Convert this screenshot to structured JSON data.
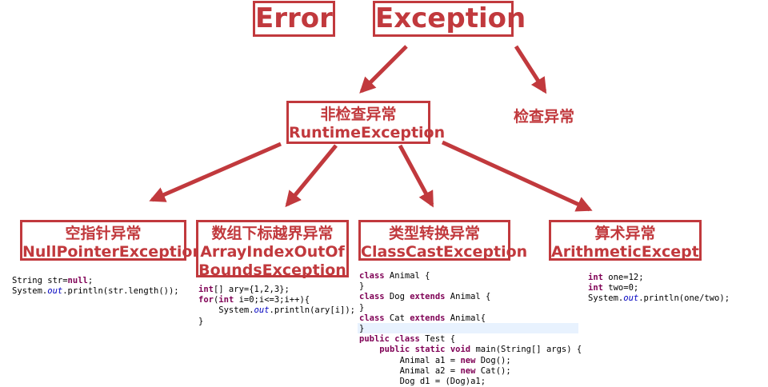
{
  "colors": {
    "accent": "#c1393d",
    "keyword": "#7f0055",
    "field": "#0000c0",
    "highlight": "#e8f2fe"
  },
  "top": {
    "error": "Error",
    "exception": "Exception"
  },
  "mid": {
    "unchecked_cn": "非检查异常",
    "unchecked_en": "RuntimeException",
    "checked_cn": "检查异常"
  },
  "leaves": [
    {
      "cn": "空指针异常",
      "en": "NullPointerException"
    },
    {
      "cn": "数组下标越界异常",
      "en": "ArrayIndexOutOfBoundsException",
      "en1": "ArrayIndexOutOf",
      "en2": "BoundsException"
    },
    {
      "cn": "类型转换异常",
      "en": "ClassCastException"
    },
    {
      "cn": "算术异常",
      "en": "ArithmeticException",
      "en_visible": "ArithmeticExceptior"
    }
  ],
  "code": {
    "null_pointer": [
      "String str=null;",
      "System.out.println(str.length());"
    ],
    "array_index": [
      "int[] ary={1,2,3};",
      "for(int i=0;i<=3;i++){",
      "    System.out.println(ary[i]);",
      "}"
    ],
    "class_cast": [
      "class Animal {",
      "}",
      "class Dog extends Animal {",
      "}",
      "class Cat extends Animal{",
      "}",
      "public class Test {",
      "    public static void main(String[] args) {",
      "        Animal a1 = new Dog();",
      "        Animal a2 = new Cat();",
      "        Dog d1 = (Dog)a1;"
    ],
    "arithmetic": [
      "int one=12;",
      "int two=0;",
      "System.out.println(one/two);"
    ]
  }
}
